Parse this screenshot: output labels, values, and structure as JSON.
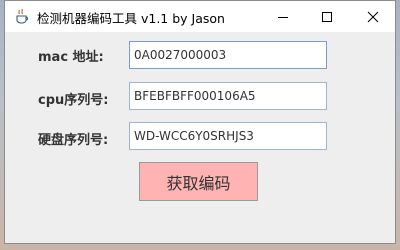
{
  "window": {
    "title": "检测机器编码工具  v1.1 by Jason",
    "icons": {
      "app": "java-cup-icon",
      "minimize": "minimize-icon",
      "maximize": "maximize-icon",
      "close": "close-icon"
    }
  },
  "form": {
    "mac_label": "mac 地址:",
    "mac_value": "0A0027000003",
    "cpu_label": "cpu序列号:",
    "cpu_value": "BFEBFBFF000106A5",
    "disk_label": "硬盘序列号:",
    "disk_value": "WD-WCC6Y0SRHJS3"
  },
  "actions": {
    "get_code_label": "获取编码"
  },
  "colors": {
    "button_bg": "#ffb3b3",
    "field_border": "#7a9cc8",
    "client_bg": "#eeeeee"
  }
}
